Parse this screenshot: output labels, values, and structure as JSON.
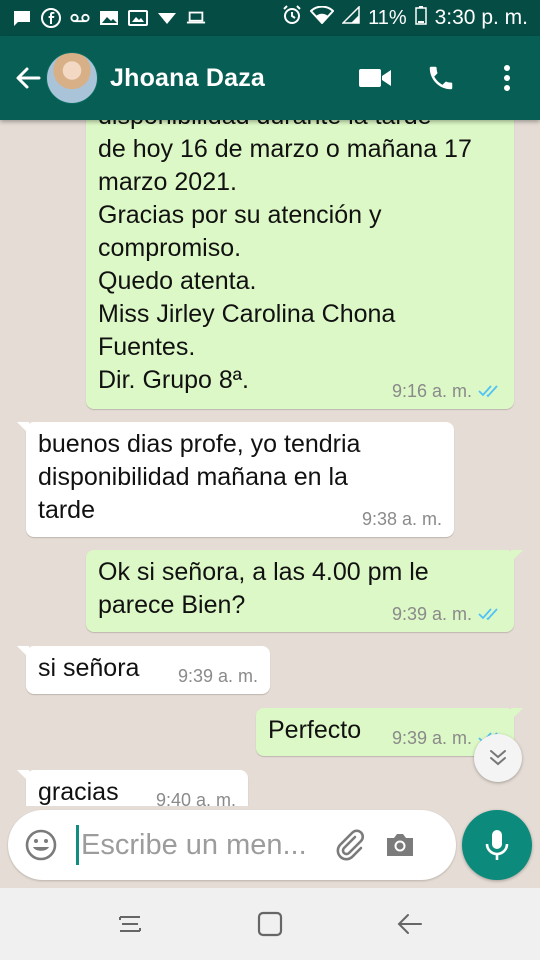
{
  "status_bar": {
    "battery": "11%",
    "time": "3:30 p. m.",
    "left_icons": [
      "message-icon",
      "facebook-icon",
      "voicemail-icon",
      "image-icon",
      "gallery-icon",
      "wifi-down-icon",
      "laptop-icon"
    ],
    "right_icons": [
      "alarm-icon",
      "wifi-icon",
      "signal-icon",
      "battery-icon"
    ]
  },
  "header": {
    "contact_name": "Jhoana Daza",
    "actions": [
      "video-call-icon",
      "phone-call-icon",
      "more-options-icon"
    ]
  },
  "messages": [
    {
      "direction": "out",
      "lines": [
        "disponibilidad durante la tarde",
        "de hoy 16 de marzo o mañana 17",
        "marzo 2021.",
        "Gracias por su atención y",
        "compromiso.",
        "Quedo atenta.",
        "Miss Jirley Carolina Chona",
        "Fuentes.",
        "Dir. Grupo 8ª."
      ],
      "time": "9:16 a. m.",
      "status": "read"
    },
    {
      "direction": "in",
      "lines": [
        "buenos dias profe, yo tendria",
        "disponibilidad mañana en la",
        "tarde"
      ],
      "time": "9:38 a. m."
    },
    {
      "direction": "out",
      "lines": [
        "Ok si señora, a las 4.00 pm le",
        "parece Bien?"
      ],
      "time": "9:39 a. m.",
      "status": "read"
    },
    {
      "direction": "in",
      "lines": [
        "si señora"
      ],
      "time": "9:39 a. m."
    },
    {
      "direction": "out",
      "lines": [
        "Perfecto"
      ],
      "time": "9:39 a. m.",
      "status": "read"
    },
    {
      "direction": "in",
      "lines": [
        "gracias"
      ],
      "time": "9:40 a. m."
    }
  ],
  "composer": {
    "placeholder": "Escribe un men..."
  },
  "colors": {
    "status_bar": "#054d44",
    "app_bar": "#075e54",
    "chat_background": "#e5ddd5",
    "outgoing_bubble": "#dcf8c6",
    "incoming_bubble": "#ffffff",
    "read_ticks": "#4fc3f7",
    "accent": "#0c8a7b"
  }
}
